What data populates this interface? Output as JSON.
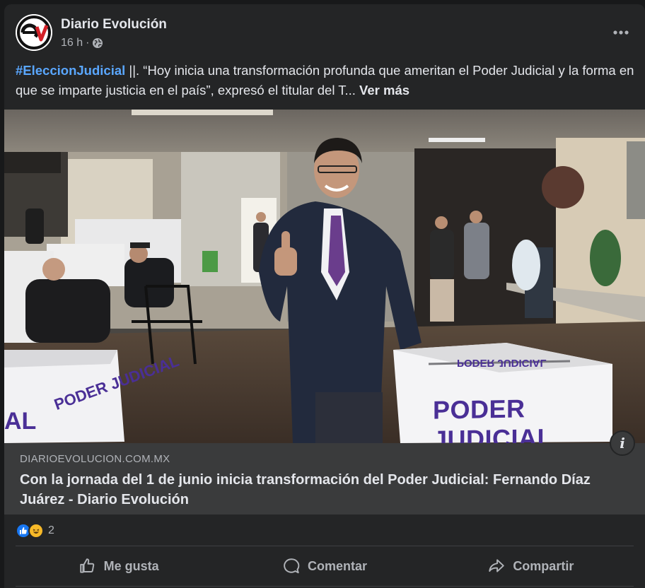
{
  "post": {
    "page_name": "Diario Evolución",
    "time": "16 h",
    "separator": "·",
    "hashtag": "#EleccionJudicial",
    "text": " ||. “Hoy inicia una transformación profunda que ameritan el Poder Judicial y la forma en que se imparte justicia en el país”, expresó el titular del T...",
    "see_more": "Ver más",
    "avatar_text": "ev"
  },
  "photo": {
    "box_label_front": "PODER JUDICIAL",
    "box_label_top": "PODER JUDICIAL",
    "box_label_left": "PODER JUDICIAL",
    "box_label_left_small": "AL"
  },
  "link": {
    "domain": "DIARIOEVOLUCION.COM.MX",
    "title": "Con la jornada del 1 de junio inicia transformación del Poder Judicial: Fernando Díaz Juárez - Diario Evolución",
    "info_label": "i"
  },
  "reactions": {
    "count": "2"
  },
  "actions": {
    "like": "Me gusta",
    "comment": "Comentar",
    "share": "Compartir"
  },
  "colors": {
    "accent": "#5aa7ff",
    "like_blue": "#1877f2",
    "haha_yellow": "#f7b928"
  }
}
